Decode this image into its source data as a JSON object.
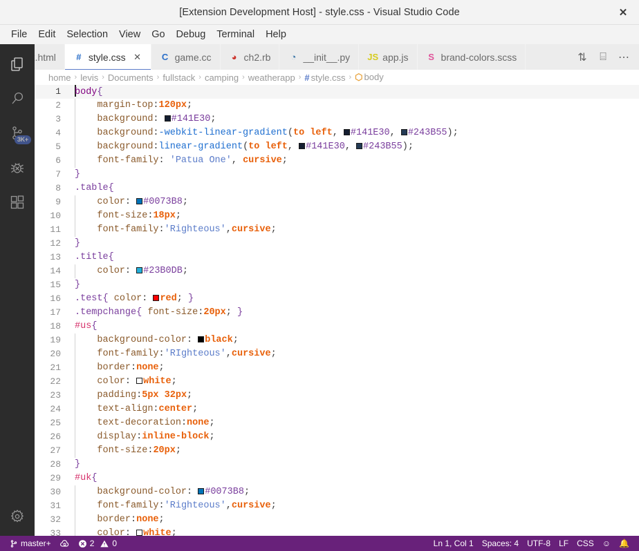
{
  "window": {
    "title": "[Extension Development Host] - style.css - Visual Studio Code",
    "close_label": "✕"
  },
  "menubar": {
    "items": [
      {
        "label": "File"
      },
      {
        "label": "Edit"
      },
      {
        "label": "Selection"
      },
      {
        "label": "View"
      },
      {
        "label": "Go"
      },
      {
        "label": "Debug"
      },
      {
        "label": "Terminal"
      },
      {
        "label": "Help"
      }
    ]
  },
  "activitybar": {
    "items": [
      {
        "name": "explorer",
        "icon": "files-icon",
        "badge": ""
      },
      {
        "name": "search",
        "icon": "search-icon",
        "badge": ""
      },
      {
        "name": "source-control",
        "icon": "source-control-icon",
        "badge": "3K+"
      },
      {
        "name": "debug",
        "icon": "debug-icon",
        "badge": ""
      },
      {
        "name": "extensions",
        "icon": "extensions-icon",
        "badge": ""
      }
    ],
    "bottom": {
      "name": "manage",
      "icon": "gear-icon"
    }
  },
  "tabs": {
    "items": [
      {
        "label": "dex.html",
        "icon": "<>",
        "icon_color": "#cc6633",
        "active": false,
        "clipped": true
      },
      {
        "label": "style.css",
        "icon": "#",
        "icon_color": "#2b6fc9",
        "active": true,
        "clipped": false,
        "close": "✕"
      },
      {
        "label": "game.cc",
        "icon": "C",
        "icon_color": "#2b6fc9",
        "active": false,
        "clipped": false
      },
      {
        "label": "ch2.rb",
        "icon": "◕",
        "icon_color": "#cc342d",
        "active": false,
        "clipped": false
      },
      {
        "label": "__init__.py",
        "icon": "◔",
        "icon_color": "#3572A5",
        "active": false,
        "clipped": false
      },
      {
        "label": "app.js",
        "icon": "JS",
        "icon_color": "#d6cc1f",
        "active": false,
        "clipped": false
      },
      {
        "label": "brand-colors.scss",
        "icon": "S",
        "icon_color": "#e0559b",
        "active": false,
        "clipped": false
      }
    ],
    "actions": [
      {
        "name": "split-editor-vertical-icon",
        "glyph": "⇅"
      },
      {
        "name": "split-editor-icon",
        "glyph": "⌸"
      },
      {
        "name": "more-actions-icon",
        "glyph": "⋯"
      }
    ]
  },
  "breadcrumbs": {
    "separator": "›",
    "items": [
      {
        "label": "home",
        "icon": ""
      },
      {
        "label": "levis",
        "icon": ""
      },
      {
        "label": "Documents",
        "icon": ""
      },
      {
        "label": "fullstack",
        "icon": ""
      },
      {
        "label": "camping",
        "icon": ""
      },
      {
        "label": "weatherapp",
        "icon": ""
      },
      {
        "label": "style.css",
        "icon": "#"
      },
      {
        "label": "body",
        "icon": "⬡"
      }
    ]
  },
  "editor": {
    "filename": "style.css",
    "cursor_line": 1,
    "lines": [
      {
        "n": 1,
        "indent": 0,
        "cursor": true,
        "tokens": [
          {
            "t": "sel",
            "v": "body"
          },
          {
            "t": "brace",
            "v": "{"
          }
        ]
      },
      {
        "n": 2,
        "indent": 1,
        "tokens": [
          {
            "t": "prop",
            "v": "margin-top"
          },
          {
            "t": "punc",
            "v": ":"
          },
          {
            "t": "num",
            "v": "120px"
          },
          {
            "t": "punc",
            "v": ";"
          }
        ]
      },
      {
        "n": 3,
        "indent": 1,
        "tokens": [
          {
            "t": "prop",
            "v": "background"
          },
          {
            "t": "punc",
            "v": ": "
          },
          {
            "t": "sw",
            "v": "#141E30"
          },
          {
            "t": "hex",
            "v": "#141E30"
          },
          {
            "t": "punc",
            "v": ";"
          }
        ]
      },
      {
        "n": 4,
        "indent": 1,
        "tokens": [
          {
            "t": "prop",
            "v": "background"
          },
          {
            "t": "punc",
            "v": ":"
          },
          {
            "t": "fn",
            "v": "-webkit-linear-gradient"
          },
          {
            "t": "punc",
            "v": "("
          },
          {
            "t": "kw",
            "v": "to left"
          },
          {
            "t": "punc",
            "v": ", "
          },
          {
            "t": "sw",
            "v": "#141E30"
          },
          {
            "t": "hex",
            "v": "#141E30"
          },
          {
            "t": "punc",
            "v": ", "
          },
          {
            "t": "sw",
            "v": "#243B55"
          },
          {
            "t": "hex",
            "v": "#243B55"
          },
          {
            "t": "punc",
            "v": ");"
          }
        ]
      },
      {
        "n": 5,
        "indent": 1,
        "tokens": [
          {
            "t": "prop",
            "v": "background"
          },
          {
            "t": "punc",
            "v": ":"
          },
          {
            "t": "fn",
            "v": "linear-gradient"
          },
          {
            "t": "punc",
            "v": "("
          },
          {
            "t": "kw",
            "v": "to left"
          },
          {
            "t": "punc",
            "v": ", "
          },
          {
            "t": "sw",
            "v": "#141E30"
          },
          {
            "t": "hex",
            "v": "#141E30"
          },
          {
            "t": "punc",
            "v": ", "
          },
          {
            "t": "sw",
            "v": "#243B55"
          },
          {
            "t": "hex",
            "v": "#243B55"
          },
          {
            "t": "punc",
            "v": ");"
          }
        ]
      },
      {
        "n": 6,
        "indent": 1,
        "tokens": [
          {
            "t": "prop",
            "v": "font-family"
          },
          {
            "t": "punc",
            "v": ": "
          },
          {
            "t": "str",
            "v": "'Patua One'"
          },
          {
            "t": "punc",
            "v": ", "
          },
          {
            "t": "kw",
            "v": "cursive"
          },
          {
            "t": "punc",
            "v": ";"
          }
        ]
      },
      {
        "n": 7,
        "indent": 0,
        "tokens": [
          {
            "t": "brace",
            "v": "}"
          }
        ]
      },
      {
        "n": 8,
        "indent": 0,
        "tokens": [
          {
            "t": "class",
            "v": ".table"
          },
          {
            "t": "brace",
            "v": "{"
          }
        ]
      },
      {
        "n": 9,
        "indent": 1,
        "tokens": [
          {
            "t": "prop",
            "v": "color"
          },
          {
            "t": "punc",
            "v": ": "
          },
          {
            "t": "sw",
            "v": "#0073B8"
          },
          {
            "t": "hex",
            "v": "#0073B8"
          },
          {
            "t": "punc",
            "v": ";"
          }
        ]
      },
      {
        "n": 10,
        "indent": 1,
        "tokens": [
          {
            "t": "prop",
            "v": "font-size"
          },
          {
            "t": "punc",
            "v": ":"
          },
          {
            "t": "num",
            "v": "18px"
          },
          {
            "t": "punc",
            "v": ";"
          }
        ]
      },
      {
        "n": 11,
        "indent": 1,
        "tokens": [
          {
            "t": "prop",
            "v": "font-family"
          },
          {
            "t": "punc",
            "v": ":"
          },
          {
            "t": "str",
            "v": "'Righteous'"
          },
          {
            "t": "punc",
            "v": ","
          },
          {
            "t": "kw",
            "v": "cursive"
          },
          {
            "t": "punc",
            "v": ";"
          }
        ]
      },
      {
        "n": 12,
        "indent": 0,
        "tokens": [
          {
            "t": "brace",
            "v": "}"
          }
        ]
      },
      {
        "n": 13,
        "indent": 0,
        "tokens": [
          {
            "t": "class",
            "v": ".title"
          },
          {
            "t": "brace",
            "v": "{"
          }
        ]
      },
      {
        "n": 14,
        "indent": 1,
        "tokens": [
          {
            "t": "prop",
            "v": "color"
          },
          {
            "t": "punc",
            "v": ": "
          },
          {
            "t": "sw",
            "v": "#23B0DB"
          },
          {
            "t": "hex",
            "v": "#23B0DB"
          },
          {
            "t": "punc",
            "v": ";"
          }
        ]
      },
      {
        "n": 15,
        "indent": 0,
        "tokens": [
          {
            "t": "brace",
            "v": "}"
          }
        ]
      },
      {
        "n": 16,
        "indent": 0,
        "tokens": [
          {
            "t": "class",
            "v": ".test"
          },
          {
            "t": "brace",
            "v": "{ "
          },
          {
            "t": "prop",
            "v": "color"
          },
          {
            "t": "punc",
            "v": ": "
          },
          {
            "t": "sw",
            "v": "#ff0000"
          },
          {
            "t": "kw",
            "v": "red"
          },
          {
            "t": "punc",
            "v": "; "
          },
          {
            "t": "brace",
            "v": "}"
          }
        ]
      },
      {
        "n": 17,
        "indent": 0,
        "tokens": [
          {
            "t": "class",
            "v": ".tempchange"
          },
          {
            "t": "brace",
            "v": "{ "
          },
          {
            "t": "prop",
            "v": "font-size"
          },
          {
            "t": "punc",
            "v": ":"
          },
          {
            "t": "num",
            "v": "20px"
          },
          {
            "t": "punc",
            "v": "; "
          },
          {
            "t": "brace",
            "v": "}"
          }
        ]
      },
      {
        "n": 18,
        "indent": 0,
        "tokens": [
          {
            "t": "id",
            "v": "#us"
          },
          {
            "t": "brace",
            "v": "{"
          }
        ]
      },
      {
        "n": 19,
        "indent": 1,
        "tokens": [
          {
            "t": "prop",
            "v": "background-color"
          },
          {
            "t": "punc",
            "v": ": "
          },
          {
            "t": "sw",
            "v": "#000000"
          },
          {
            "t": "kw",
            "v": "black"
          },
          {
            "t": "punc",
            "v": ";"
          }
        ]
      },
      {
        "n": 20,
        "indent": 1,
        "tokens": [
          {
            "t": "prop",
            "v": "font-family"
          },
          {
            "t": "punc",
            "v": ":"
          },
          {
            "t": "str",
            "v": "'RIghteous'"
          },
          {
            "t": "punc",
            "v": ","
          },
          {
            "t": "kw",
            "v": "cursive"
          },
          {
            "t": "punc",
            "v": ";"
          }
        ]
      },
      {
        "n": 21,
        "indent": 1,
        "tokens": [
          {
            "t": "prop",
            "v": "border"
          },
          {
            "t": "punc",
            "v": ":"
          },
          {
            "t": "kw",
            "v": "none"
          },
          {
            "t": "punc",
            "v": ";"
          }
        ]
      },
      {
        "n": 22,
        "indent": 1,
        "tokens": [
          {
            "t": "prop",
            "v": "color"
          },
          {
            "t": "punc",
            "v": ": "
          },
          {
            "t": "sw",
            "v": "#ffffff"
          },
          {
            "t": "kw",
            "v": "white"
          },
          {
            "t": "punc",
            "v": ";"
          }
        ]
      },
      {
        "n": 23,
        "indent": 1,
        "tokens": [
          {
            "t": "prop",
            "v": "padding"
          },
          {
            "t": "punc",
            "v": ":"
          },
          {
            "t": "num",
            "v": "5px 32px"
          },
          {
            "t": "punc",
            "v": ";"
          }
        ]
      },
      {
        "n": 24,
        "indent": 1,
        "tokens": [
          {
            "t": "prop",
            "v": "text-align"
          },
          {
            "t": "punc",
            "v": ":"
          },
          {
            "t": "kw",
            "v": "center"
          },
          {
            "t": "punc",
            "v": ";"
          }
        ]
      },
      {
        "n": 25,
        "indent": 1,
        "tokens": [
          {
            "t": "prop",
            "v": "text-decoration"
          },
          {
            "t": "punc",
            "v": ":"
          },
          {
            "t": "kw",
            "v": "none"
          },
          {
            "t": "punc",
            "v": ";"
          }
        ]
      },
      {
        "n": 26,
        "indent": 1,
        "tokens": [
          {
            "t": "prop",
            "v": "display"
          },
          {
            "t": "punc",
            "v": ":"
          },
          {
            "t": "kw",
            "v": "inline-block"
          },
          {
            "t": "punc",
            "v": ";"
          }
        ]
      },
      {
        "n": 27,
        "indent": 1,
        "tokens": [
          {
            "t": "prop",
            "v": "font-size"
          },
          {
            "t": "punc",
            "v": ":"
          },
          {
            "t": "num",
            "v": "20px"
          },
          {
            "t": "punc",
            "v": ";"
          }
        ]
      },
      {
        "n": 28,
        "indent": 0,
        "tokens": [
          {
            "t": "brace",
            "v": "}"
          }
        ]
      },
      {
        "n": 29,
        "indent": 0,
        "tokens": [
          {
            "t": "id",
            "v": "#uk"
          },
          {
            "t": "brace",
            "v": "{"
          }
        ]
      },
      {
        "n": 30,
        "indent": 1,
        "tokens": [
          {
            "t": "prop",
            "v": "background-color"
          },
          {
            "t": "punc",
            "v": ": "
          },
          {
            "t": "sw",
            "v": "#0073B8"
          },
          {
            "t": "hex",
            "v": "#0073B8"
          },
          {
            "t": "punc",
            "v": ";"
          }
        ]
      },
      {
        "n": 31,
        "indent": 1,
        "tokens": [
          {
            "t": "prop",
            "v": "font-family"
          },
          {
            "t": "punc",
            "v": ":"
          },
          {
            "t": "str",
            "v": "'Righteous'"
          },
          {
            "t": "punc",
            "v": ","
          },
          {
            "t": "kw",
            "v": "cursive"
          },
          {
            "t": "punc",
            "v": ";"
          }
        ]
      },
      {
        "n": 32,
        "indent": 1,
        "tokens": [
          {
            "t": "prop",
            "v": "border"
          },
          {
            "t": "punc",
            "v": ":"
          },
          {
            "t": "kw",
            "v": "none"
          },
          {
            "t": "punc",
            "v": ";"
          }
        ]
      },
      {
        "n": 33,
        "indent": 1,
        "tokens": [
          {
            "t": "prop",
            "v": "color"
          },
          {
            "t": "punc",
            "v": ": "
          },
          {
            "t": "sw",
            "v": "#ffffff"
          },
          {
            "t": "kw",
            "v": "white"
          },
          {
            "t": "punc",
            "v": ";"
          }
        ]
      }
    ]
  },
  "statusbar": {
    "background": "#68217a",
    "left": [
      {
        "name": "branch",
        "icon": "⎇",
        "label": "master+"
      },
      {
        "name": "sync",
        "icon": "⟳",
        "label": ""
      },
      {
        "name": "problems",
        "icon": "⊗",
        "label": "2",
        "icon2": "⚠",
        "label2": "0"
      }
    ],
    "right": [
      {
        "name": "cursor-position",
        "label": "Ln 1, Col 1"
      },
      {
        "name": "indentation",
        "label": "Spaces: 4"
      },
      {
        "name": "encoding",
        "label": "UTF-8"
      },
      {
        "name": "eol",
        "label": "LF"
      },
      {
        "name": "language-mode",
        "label": "CSS"
      },
      {
        "name": "feedback",
        "label": "☺"
      },
      {
        "name": "notifications",
        "label": "🔔"
      }
    ]
  }
}
